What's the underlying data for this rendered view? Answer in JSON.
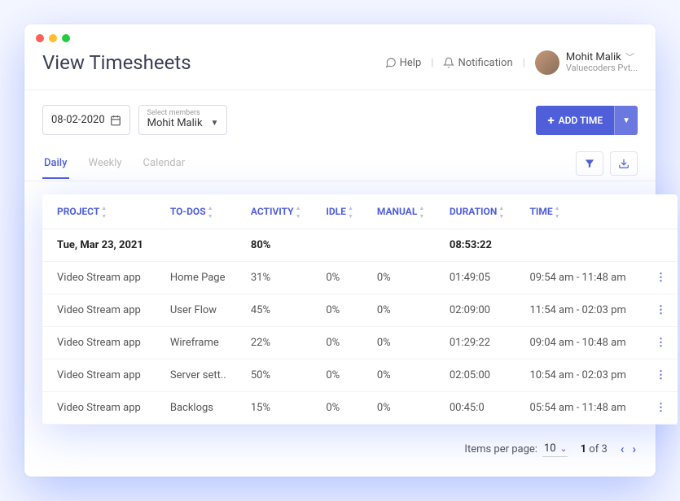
{
  "header": {
    "title": "View Timesheets",
    "help_label": "Help",
    "notification_label": "Notification",
    "user": {
      "name": "Mohit Malik",
      "company": "Valuecoders Pvt..."
    }
  },
  "controls": {
    "date_value": "08-02-2020",
    "member_label": "Select members",
    "member_value": "Mohit Malik",
    "add_time_label": "ADD TIME"
  },
  "tabs": [
    "Daily",
    "Weekly",
    "Calendar"
  ],
  "active_tab": 0,
  "columns": [
    "PROJECT",
    "TO-DOS",
    "ACTIVITY",
    "IDLE",
    "MANUAL",
    "DURATION",
    "TIME"
  ],
  "summary": {
    "date": "Tue, Mar 23, 2021",
    "activity": "80%",
    "duration": "08:53:22"
  },
  "rows": [
    {
      "project": "Video Stream app",
      "todo": "Home Page",
      "activity": "31%",
      "idle": "0%",
      "manual": "0%",
      "duration": "01:49:05",
      "time": "09:54 am - 11:48 am"
    },
    {
      "project": "Video Stream app",
      "todo": "User Flow",
      "activity": "45%",
      "idle": "0%",
      "manual": "0%",
      "duration": "02:09:00",
      "time": "11:54 am - 02:03 pm"
    },
    {
      "project": "Video Stream app",
      "todo": "Wireframe",
      "activity": "22%",
      "idle": "0%",
      "manual": "0%",
      "duration": "01:29:22",
      "time": "09:04 am - 10:48 am"
    },
    {
      "project": "Video Stream app",
      "todo": "Server sett..",
      "activity": "50%",
      "idle": "0%",
      "manual": "0%",
      "duration": "02:05:00",
      "time": "10:54 am - 02:03 pm"
    },
    {
      "project": "Video Stream app",
      "todo": "Backlogs",
      "activity": "15%",
      "idle": "0%",
      "manual": "0%",
      "duration": "00:45:0",
      "time": "05:54 am - 11:48 am"
    }
  ],
  "pager": {
    "ipp_label": "Items per page:",
    "ipp_value": "10",
    "page_current": "1",
    "page_total": "3"
  }
}
